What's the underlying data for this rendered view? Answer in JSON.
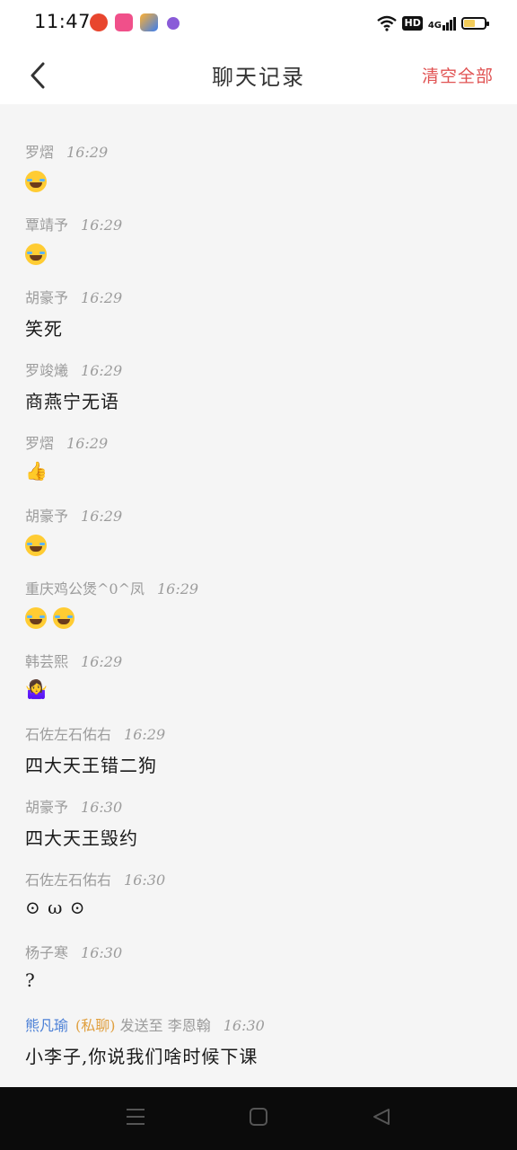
{
  "status_bar": {
    "time": "11:47",
    "network": "4G",
    "hd_badge": "HD",
    "battery_level": 0.55,
    "notification_icons": [
      "taobao-icon",
      "weibo-icon",
      "app-icon",
      "app-icon"
    ]
  },
  "header": {
    "title": "聊天记录",
    "clear_label": "清空全部"
  },
  "messages": [
    {
      "sender": "罗熠",
      "time": "16:29",
      "content": "",
      "emoji": "laugh",
      "emoji_count": 1
    },
    {
      "sender": "覃靖予",
      "time": "16:29",
      "content": "",
      "emoji": "laugh",
      "emoji_count": 1
    },
    {
      "sender": "胡豪予",
      "time": "16:29",
      "content": "笑死"
    },
    {
      "sender": "罗竣爔",
      "time": "16:29",
      "content": "商燕宁无语"
    },
    {
      "sender": "罗熠",
      "time": "16:29",
      "content": "👍"
    },
    {
      "sender": "胡豪予",
      "time": "16:29",
      "content": "",
      "emoji": "laugh",
      "emoji_count": 1
    },
    {
      "sender": "重庆鸡公煲^0^凤",
      "time": "16:29",
      "content": "",
      "emoji": "laugh",
      "emoji_count": 2
    },
    {
      "sender": "韩芸熙",
      "time": "16:29",
      "content": "🤷‍♀️"
    },
    {
      "sender": "石佐左石佑右",
      "time": "16:29",
      "content": "四大天王错二狗"
    },
    {
      "sender": "胡豪予",
      "time": "16:30",
      "content": "四大天王毁约"
    },
    {
      "sender": "石佐左石佑右",
      "time": "16:30",
      "content": "⊙ ω ⊙"
    },
    {
      "sender": "杨子寒",
      "time": "16:30",
      "content": "?"
    },
    {
      "sender": "熊凡瑜",
      "private_tag": "(私聊)",
      "sent_to_label": "发送至",
      "recipient": "李恩翰",
      "time": "16:30",
      "content": "小李子,你说我们啥时候下课"
    }
  ],
  "nav_bar": {
    "icons": [
      "menu-icon",
      "home-icon",
      "back-triangle-icon"
    ]
  },
  "colors": {
    "clear_button": "#e05353",
    "private_sender": "#4a7fd6",
    "private_tag": "#e0a040",
    "meta_text": "#9c9c9c"
  }
}
